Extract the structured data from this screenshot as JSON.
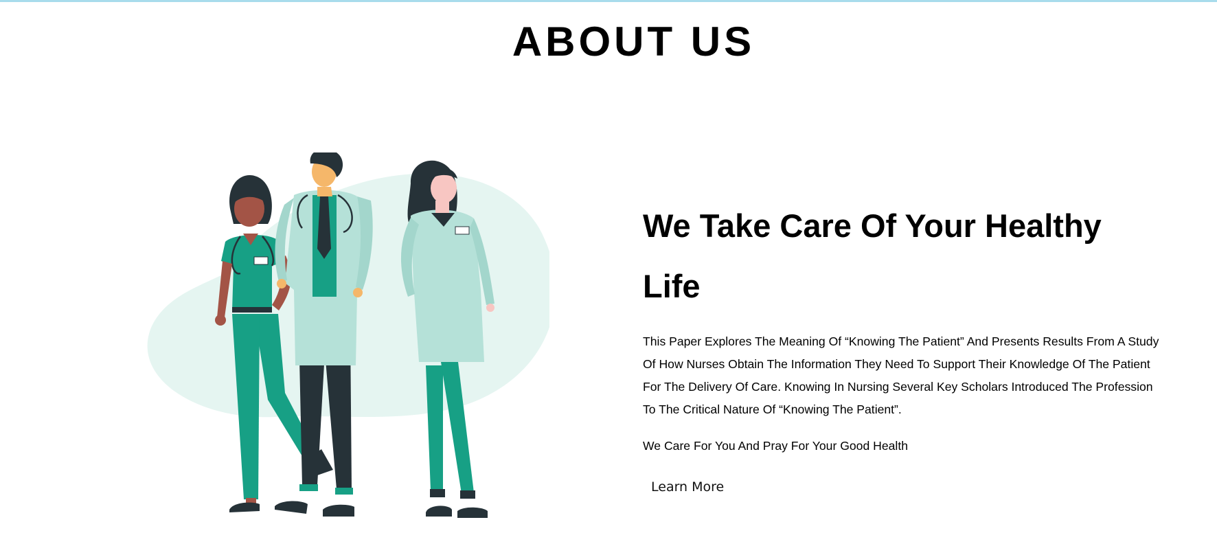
{
  "theme": {
    "top_strip": "#a8dcec",
    "blob": "#e5f5f1",
    "scrubs": "#17a085",
    "coat": "#b5e1d8",
    "dark": "#263238"
  },
  "about": {
    "title": "ABOUT US",
    "headline": "We Take Care Of Your Healthy Life",
    "paragraph": "This Paper Explores The Meaning Of “Knowing The Patient” And Presents Results From A Study Of How Nurses Obtain The Information They Need To Support Their Knowledge Of The Patient For The Delivery Of Care. Knowing In Nursing Several Key Scholars Introduced The Profession To The Critical Nature Of “Knowing The Patient”.",
    "tagline": "We Care For You And Pray For Your Good Health",
    "cta_label": "Learn More"
  },
  "illustration": {
    "subject": "three medical staff figures in scrubs and lab coats"
  }
}
